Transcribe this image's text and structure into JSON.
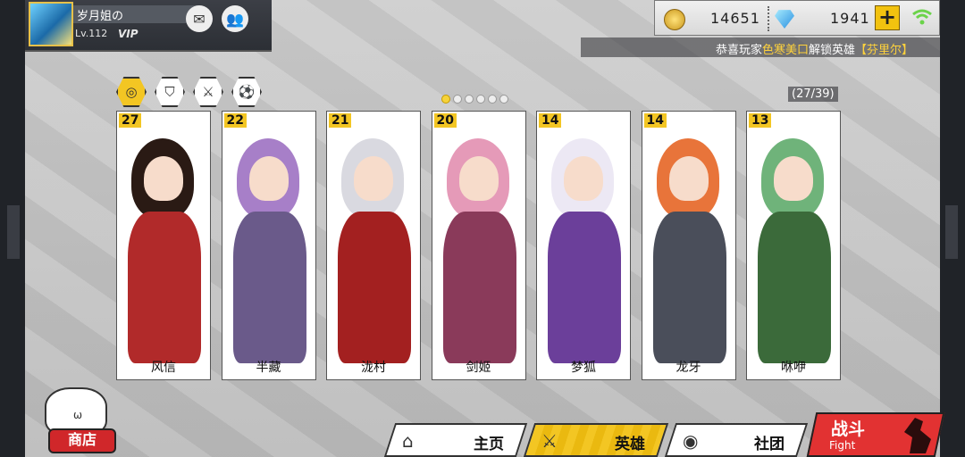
{
  "profile": {
    "name": "岁月姐の",
    "level": "Lv.112",
    "vip": "VIP"
  },
  "currency": {
    "coins": "14651",
    "gems": "1941"
  },
  "announcement": {
    "prefix": "恭喜玩家",
    "player": "色寒美口",
    "middle": "解锁英雄",
    "hero": "【芬里尔】"
  },
  "collection_count": "(27/39)",
  "pager": {
    "total": 6,
    "current": 1
  },
  "heroes": [
    {
      "level": "27",
      "name": "风信",
      "color": "#b12a2a",
      "hair": "#2a1a14"
    },
    {
      "level": "22",
      "name": "半藏",
      "color": "#6a5a8a",
      "hair": "#a77fc8"
    },
    {
      "level": "21",
      "name": "泷村",
      "color": "#a32020",
      "hair": "#d9d9e0"
    },
    {
      "level": "20",
      "name": "剑姬",
      "color": "#8a3a5a",
      "hair": "#e59ab8"
    },
    {
      "level": "14",
      "name": "梦狐",
      "color": "#6b3f9a",
      "hair": "#ece8f4"
    },
    {
      "level": "14",
      "name": "龙牙",
      "color": "#4a4e5a",
      "hair": "#e8743a"
    },
    {
      "level": "13",
      "name": "咻咿",
      "color": "#3b6a3a",
      "hair": "#6fb37a"
    }
  ],
  "shop": {
    "label": "商店"
  },
  "nav": [
    {
      "label": "主页",
      "icon": "home-icon"
    },
    {
      "label": "英雄",
      "icon": "hero-icon"
    },
    {
      "label": "社团",
      "icon": "guild-icon"
    }
  ],
  "fight": {
    "label_cn": "战斗",
    "label_en": "Fight"
  }
}
